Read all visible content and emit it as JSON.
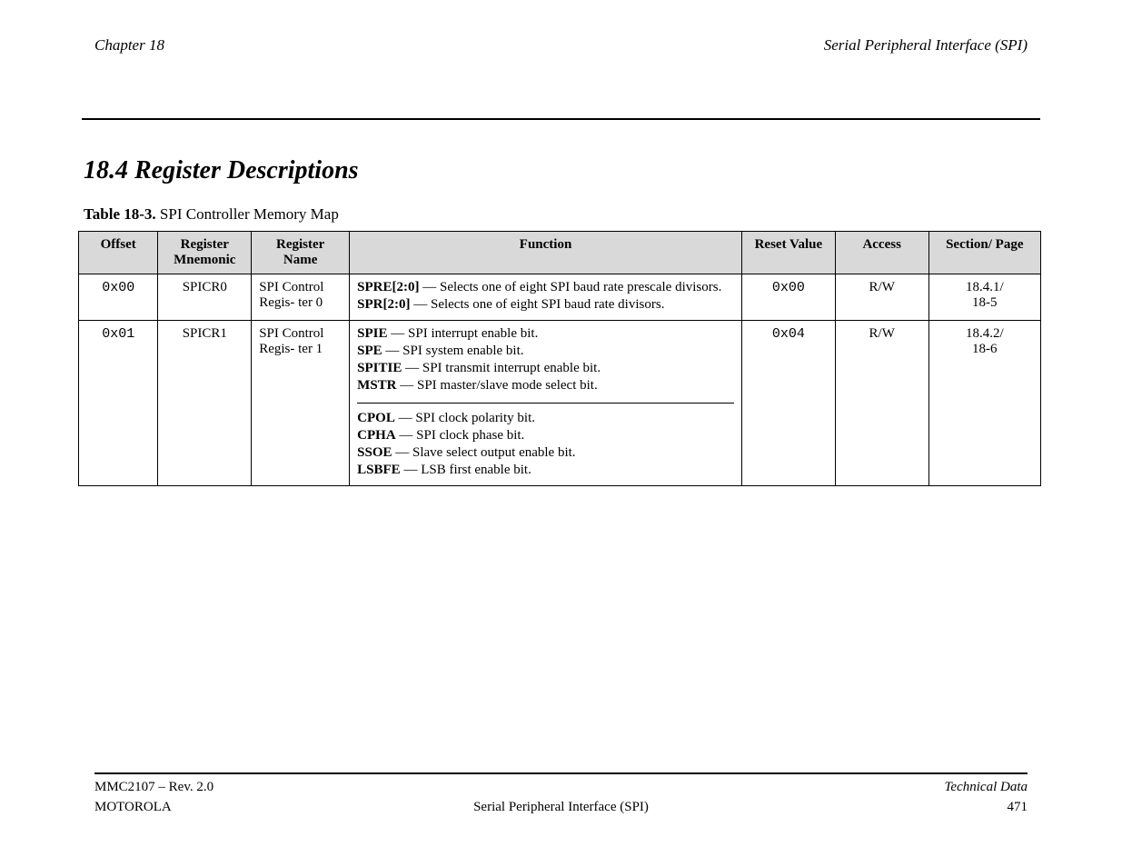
{
  "header": {
    "chapter": "Chapter 18",
    "right": "Serial Peripheral Interface (SPI)"
  },
  "section_title": "18.4 Register Descriptions",
  "table_caption_label": "Table 18-3.",
  "table_caption_text": "SPI Controller Memory Map",
  "columns": [
    "Offset",
    "Register Mnemonic",
    "Register Name",
    "Function",
    "Reset Value",
    "Access",
    "Section/ Page"
  ],
  "rows": [
    {
      "offset": "0x00",
      "mnemonic": "SPICR0",
      "name": "SPI Control Regis- ter 0",
      "func_lines": [
        {
          "bold": "SPRE[2:0]",
          "rest": " — Selects one of eight SPI baud rate prescale divisors."
        },
        {
          "bold": "SPR[2:0]",
          "rest": " — Selects one of eight SPI baud rate divisors."
        }
      ],
      "func_hr": false,
      "func_lines2": [],
      "reset": "0x00",
      "access": "R/W",
      "section": "18.4.1/",
      "page": "18-5"
    },
    {
      "offset": "0x01",
      "mnemonic": "SPICR1",
      "name": "SPI Control Regis- ter 1",
      "func_lines": [
        {
          "bold": "SPIE",
          "rest": " — SPI interrupt enable bit."
        },
        {
          "bold": "SPE",
          "rest": " — SPI system enable bit."
        },
        {
          "bold": "SPITIE",
          "rest": " — SPI transmit interrupt enable bit."
        },
        {
          "bold": "MSTR",
          "rest": " — SPI master/slave mode select bit."
        }
      ],
      "func_hr": true,
      "func_lines2": [
        {
          "bold": "CPOL",
          "rest": " — SPI clock polarity bit."
        },
        {
          "bold": "CPHA",
          "rest": " — SPI clock phase bit."
        },
        {
          "bold": "SSOE",
          "rest": " — Slave select output enable bit."
        },
        {
          "bold": "LSBFE",
          "rest": " — LSB first enable bit."
        }
      ],
      "reset": "0x04",
      "access": "R/W",
      "section": "18.4.2/",
      "page": "18-6"
    }
  ],
  "footer": {
    "left": "MMC2107 – Rev. 2.0",
    "center": "",
    "right_top": "Technical Data",
    "left2": "MOTOROLA",
    "center2": "Serial Peripheral Interface (SPI)",
    "right2": "471"
  }
}
